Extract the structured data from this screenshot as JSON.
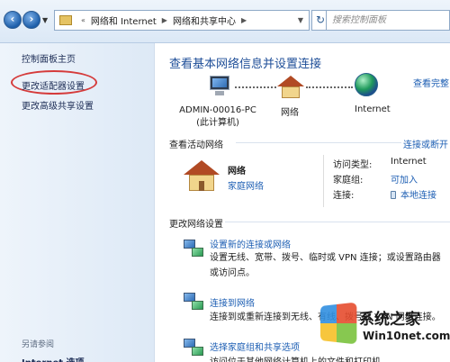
{
  "address_bar": {
    "path": [
      "网络和 Internet",
      "网络和共享中心"
    ],
    "search_placeholder": "搜索控制面板"
  },
  "left_pane": {
    "links": [
      "控制面板主页",
      "更改适配器设置",
      "更改高级共享设置"
    ],
    "see_also_heading": "另请参阅",
    "see_also_links": [
      "Internet 选项"
    ]
  },
  "main": {
    "title": "查看基本网络信息并设置连接",
    "view_full_map": "查看完整",
    "map": {
      "computer_name": "ADMIN-00016-PC",
      "computer_sub": "(此计算机)",
      "network": "网络",
      "internet": "Internet"
    },
    "active_networks": {
      "heading": "查看活动网络",
      "disconnect_link": "连接或断开",
      "network_name": "网络",
      "network_type": "家庭网络",
      "rows": [
        {
          "key": "访问类型:",
          "value": "Internet"
        },
        {
          "key": "家庭组:",
          "value": "可加入"
        },
        {
          "key": "连接:",
          "value": "本地连接"
        }
      ]
    },
    "change_settings": {
      "heading": "更改网络设置",
      "tasks": [
        {
          "title": "设置新的连接或网络",
          "desc": "设置无线、宽带、拨号、临时或 VPN 连接；或设置路由器或访问点。"
        },
        {
          "title": "连接到网络",
          "desc": "连接到或重新连接到无线、有线、拨号或 VPN 网络连接。"
        },
        {
          "title": "选择家庭组和共享选项",
          "desc": "访问位于其他网络计算机上的文件和打印机。"
        }
      ]
    }
  },
  "watermark": {
    "line1": "系统之家",
    "line2": "Win10net.com"
  },
  "colors": {
    "link": "#1c5eb3",
    "title": "#1e4e98",
    "highlight_circle": "#d53b3b",
    "pane_bg": "#e6eef8"
  }
}
